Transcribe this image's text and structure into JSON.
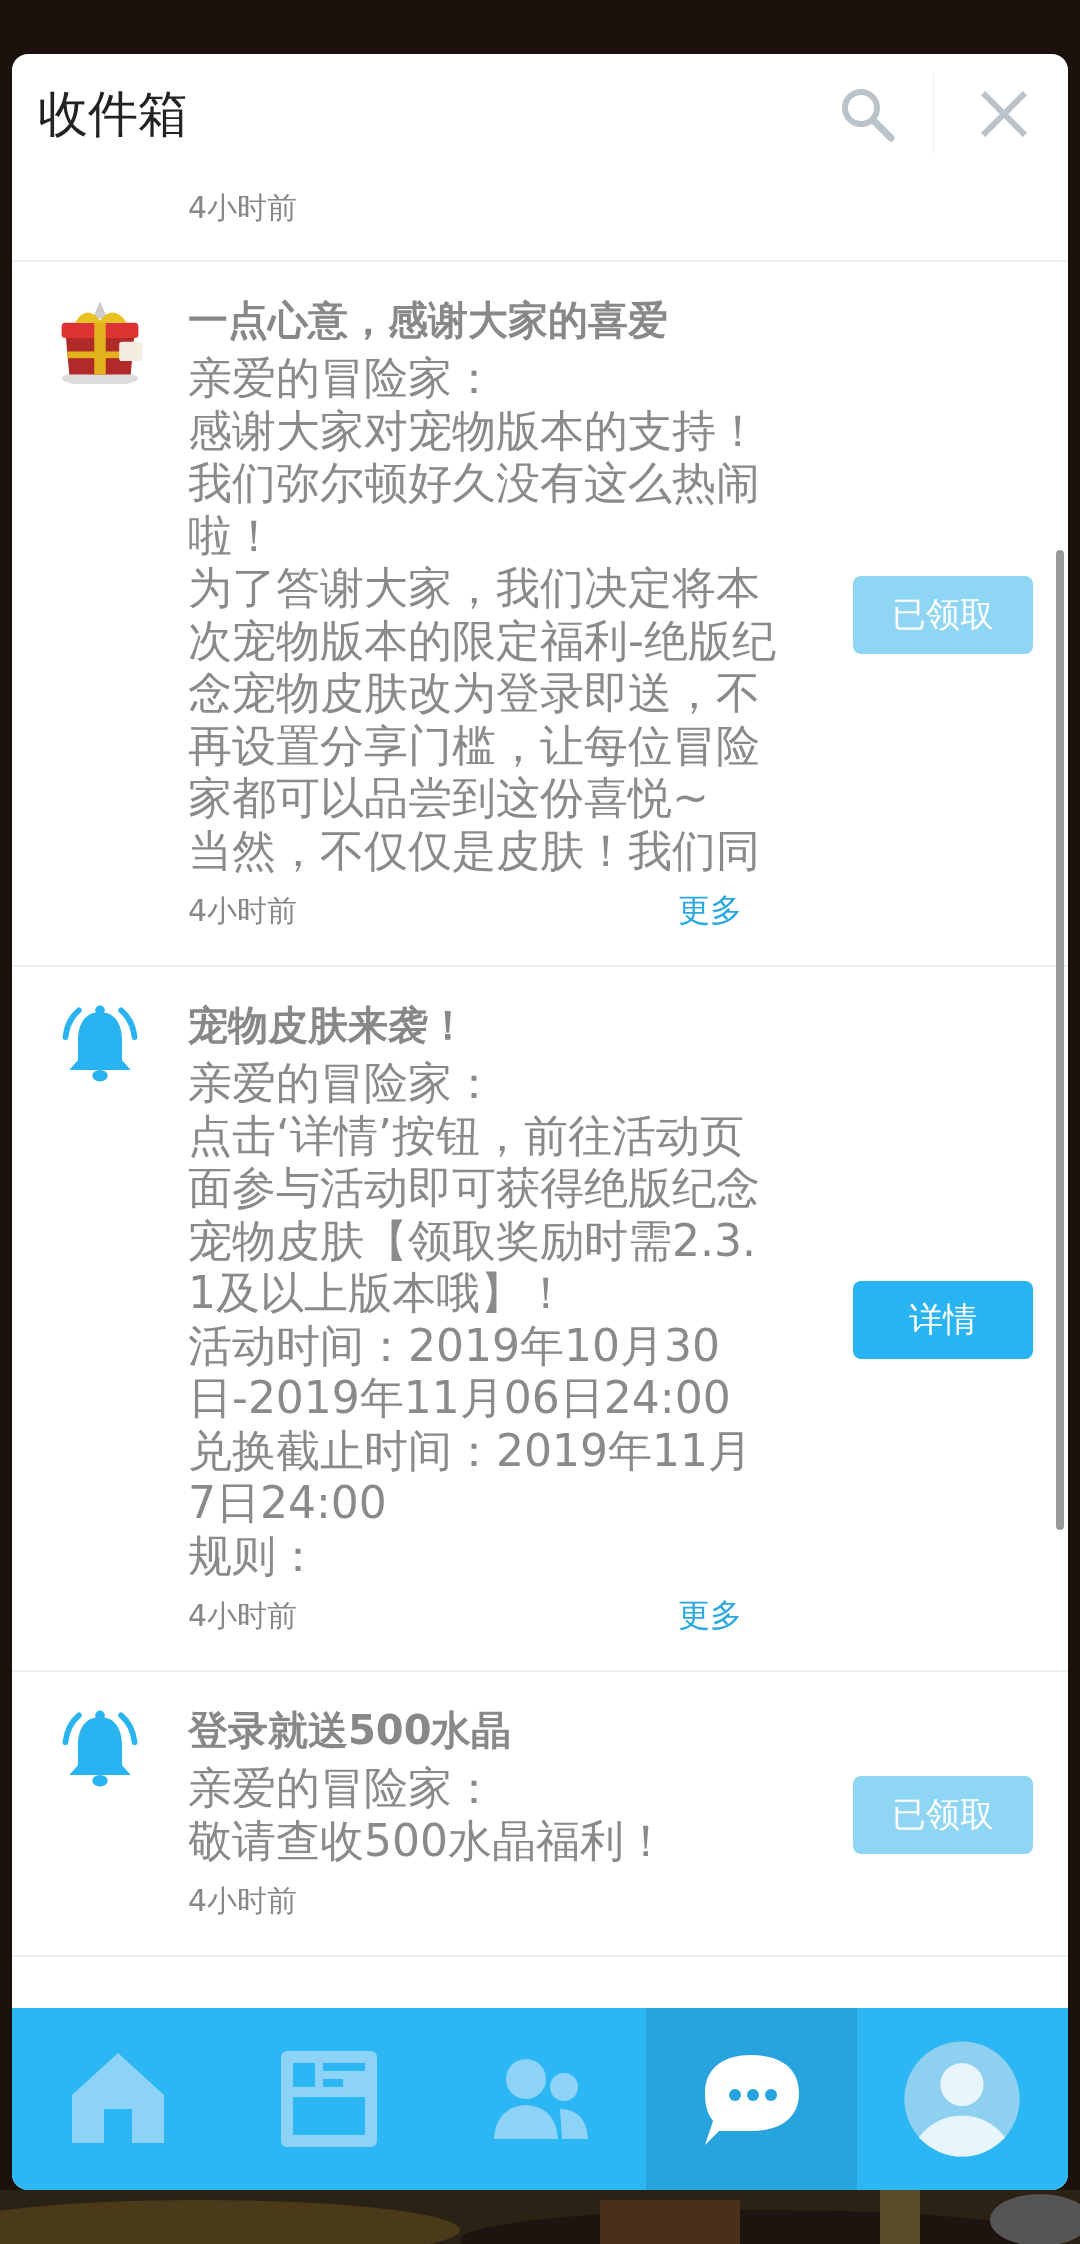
{
  "header": {
    "title": "收件箱"
  },
  "messages": [
    {
      "time": "4小时前"
    },
    {
      "kind": "chest",
      "title": "一点心意，感谢大家的喜爱",
      "body": [
        "亲爱的冒险家：",
        "感谢大家对宠物版本的支持！",
        "我们弥尔顿好久没有这么热闹啦！",
        "为了答谢大家，我们决定将本次宠物版本的限定福利-绝版纪念宠物皮肤改为登录即送，不再设置分享门槛，让每位冒险家都可以品尝到这份喜悦~",
        "当然，不仅仅是皮肤！我们同"
      ],
      "time": "4小时前",
      "more": "更多",
      "button": {
        "label": "已领取",
        "disabled": true
      }
    },
    {
      "kind": "bell",
      "title": "宠物皮肤来袭！",
      "body": [
        "亲爱的冒险家：",
        "点击‘详情’按钮，前往活动页面参与活动即可获得绝版纪念宠物皮肤【领取奖励时需2.3.1及以上版本哦】！",
        "活动时间：2019年10月30日-2019年11月06日24:00",
        "兑换截止时间：2019年11月7日24:00",
        "规则："
      ],
      "time": "4小时前",
      "more": "更多",
      "button": {
        "label": "详情",
        "disabled": false
      }
    },
    {
      "kind": "bell",
      "title": "登录就送500水晶",
      "body": [
        "亲爱的冒险家：",
        "敬请查收500水晶福利！"
      ],
      "time": "4小时前",
      "button": {
        "label": "已领取",
        "disabled": true
      }
    }
  ],
  "nav": [
    {
      "kind": "home",
      "selected": false
    },
    {
      "kind": "news",
      "selected": false
    },
    {
      "kind": "friends",
      "selected": false
    },
    {
      "kind": "chat",
      "selected": true
    },
    {
      "kind": "profile",
      "selected": false
    }
  ]
}
